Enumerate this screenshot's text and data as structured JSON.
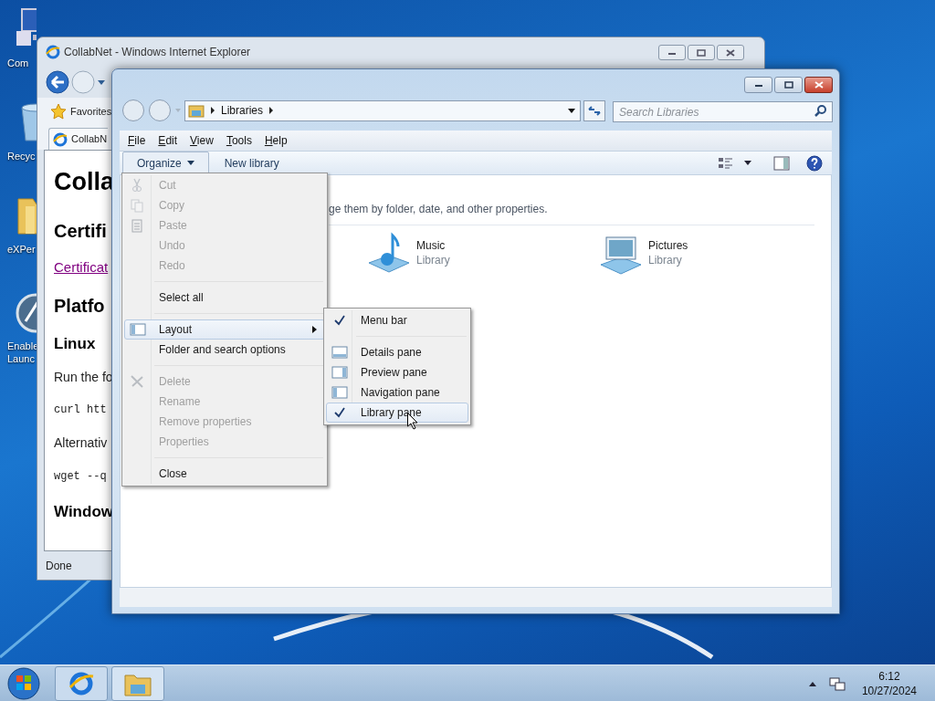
{
  "desktop_icons": [
    {
      "kind": "computer",
      "lines": [
        "Com"
      ]
    },
    {
      "kind": "recycle",
      "lines": [
        "Recyc"
      ]
    },
    {
      "kind": "folder",
      "lines": [
        "eXPer"
      ]
    },
    {
      "kind": "app",
      "lines": [
        "Enable",
        "Launc"
      ]
    }
  ],
  "ie_window": {
    "title": "CollabNet - Windows Internet Explorer",
    "active": false,
    "favorites": "Favorites",
    "tab": "CollabN",
    "content": [
      {
        "kind": "h1",
        "text": "Colla"
      },
      {
        "kind": "h2",
        "text": "Certifi"
      },
      {
        "kind": "link",
        "text": "Certificat"
      },
      {
        "kind": "h2",
        "text": "Platfo"
      },
      {
        "kind": "h3",
        "text": "Linux"
      },
      {
        "kind": "p",
        "text": "Run the fo"
      },
      {
        "kind": "code",
        "text": "curl htt"
      },
      {
        "kind": "p",
        "text": "Alternativ"
      },
      {
        "kind": "code",
        "text": "wget --q"
      },
      {
        "kind": "h3",
        "text": "Window"
      }
    ],
    "status": "Done"
  },
  "explorer_window": {
    "active": true,
    "breadcrumb": [
      "Libraries"
    ],
    "search": {
      "placeholder": "Search Libraries"
    },
    "menu_bar": [
      "File",
      "Edit",
      "View",
      "Tools",
      "Help"
    ],
    "toolbar": {
      "organize": "Organize",
      "new_library": "New library"
    },
    "description": "ge them by folder, date, and other properties.",
    "libraries": [
      {
        "name": "Music",
        "type": "Library"
      },
      {
        "name": "Pictures",
        "type": "Library"
      }
    ]
  },
  "organize_menu": {
    "items": [
      {
        "kind": "item",
        "label": "Cut",
        "disabled": true,
        "selected": false
      },
      {
        "kind": "item",
        "label": "Copy",
        "disabled": true,
        "selected": false
      },
      {
        "kind": "item",
        "label": "Paste",
        "disabled": true,
        "selected": false
      },
      {
        "kind": "item",
        "label": "Undo",
        "disabled": true,
        "selected": false
      },
      {
        "kind": "item",
        "label": "Redo",
        "disabled": true,
        "selected": false
      },
      {
        "kind": "separator"
      },
      {
        "kind": "item",
        "label": "Select all",
        "disabled": false,
        "selected": false
      },
      {
        "kind": "separator"
      },
      {
        "kind": "item",
        "label": "Layout",
        "disabled": false,
        "selected": true,
        "submenu": true
      },
      {
        "kind": "item",
        "label": "Folder and search options",
        "disabled": false,
        "selected": false
      },
      {
        "kind": "separator"
      },
      {
        "kind": "item",
        "label": "Delete",
        "disabled": true,
        "selected": false
      },
      {
        "kind": "item",
        "label": "Rename",
        "disabled": true,
        "selected": false
      },
      {
        "kind": "item",
        "label": "Remove properties",
        "disabled": true,
        "selected": false
      },
      {
        "kind": "item",
        "label": "Properties",
        "disabled": true,
        "selected": false
      },
      {
        "kind": "separator"
      },
      {
        "kind": "item",
        "label": "Close",
        "disabled": false,
        "selected": false
      }
    ]
  },
  "layout_submenu": {
    "items": [
      {
        "kind": "item",
        "label": "Menu bar",
        "checked": true,
        "selected": false
      },
      {
        "kind": "separator"
      },
      {
        "kind": "item",
        "label": "Details pane",
        "checked": false,
        "selected": false
      },
      {
        "kind": "item",
        "label": "Preview pane",
        "checked": false,
        "selected": false
      },
      {
        "kind": "item",
        "label": "Navigation pane",
        "checked": false,
        "selected": false
      },
      {
        "kind": "item",
        "label": "Library pane",
        "checked": true,
        "selected": true
      }
    ]
  },
  "taskbar": {
    "time": "6:12",
    "date": "10/27/2024"
  }
}
